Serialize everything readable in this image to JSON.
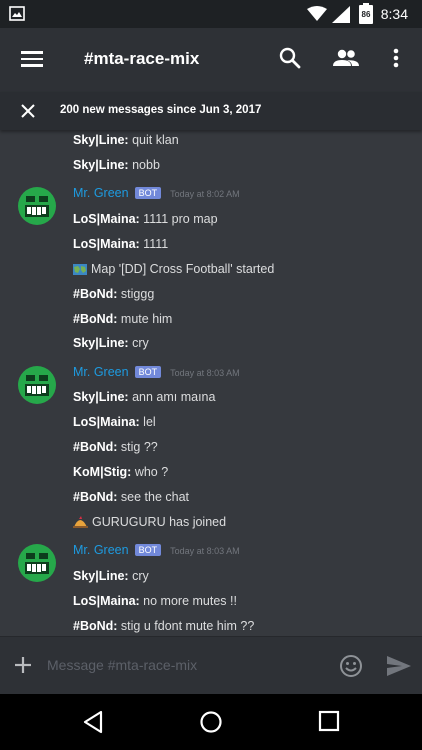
{
  "status": {
    "time": "8:34",
    "battery": "86"
  },
  "header": {
    "channel": "#mta-race-mix"
  },
  "banner": {
    "text": "200 new messages since Jun 3, 2017"
  },
  "messages": [
    {
      "author": "Sky|Line:",
      "text": " quit klan"
    },
    {
      "author": "Sky|Line:",
      "text": " nobb"
    },
    {
      "author": "LoS|Maina:",
      "text": " 1111 pro map"
    },
    {
      "author": "LoS|Maina:",
      "text": " 1111"
    },
    {
      "author": "",
      "text": "Map '[DD] Cross Football' started"
    },
    {
      "author": "#BoNd:",
      "text": " stiggg"
    },
    {
      "author": "#BoNd:",
      "text": " mute him"
    },
    {
      "author": "Sky|Line:",
      "text": " cry"
    },
    {
      "author": "Sky|Line:",
      "text": " ann amı maına"
    },
    {
      "author": "LoS|Maina:",
      "text": " lel"
    },
    {
      "author": "#BoNd:",
      "text": " stig ??"
    },
    {
      "author": "KoM|Stig:",
      "text": " who ?"
    },
    {
      "author": "#BoNd:",
      "text": " see the chat"
    },
    {
      "author": "",
      "text": "GURUGURU has joined"
    },
    {
      "author": "Sky|Line:",
      "text": " cry"
    },
    {
      "author": "LoS|Maina:",
      "text": " no more mutes !!"
    },
    {
      "author": "#BoNd:",
      "text": " stig u fdont mute him ??"
    }
  ],
  "groups": [
    {
      "name": "Mr. Green",
      "badge": "BOT",
      "time": "Today at 8:02 AM"
    },
    {
      "name": "Mr. Green",
      "badge": "BOT",
      "time": "Today at 8:03 AM"
    },
    {
      "name": "Mr. Green",
      "badge": "BOT",
      "time": "Today at 8:03 AM"
    }
  ],
  "composer": {
    "placeholder": "Message #mta-race-mix"
  },
  "colors": {
    "link": "#1e9be0",
    "bot_badge": "#7289da",
    "background": "#36393e",
    "avatar": "#26a84a"
  },
  "icons": [
    "menu-icon",
    "search-icon",
    "members-icon",
    "more-vert-icon",
    "close-icon",
    "map-icon",
    "join-icon",
    "plus-icon",
    "emoji-icon",
    "send-icon",
    "back-icon",
    "home-icon",
    "recents-icon"
  ]
}
